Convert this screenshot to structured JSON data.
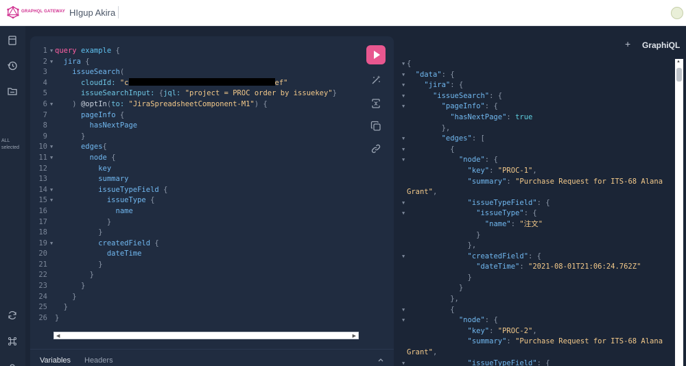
{
  "header": {
    "logo_text": "GRAPHQL GATEWAY",
    "site_name": "HIgup Akira"
  },
  "sidebar": {
    "icons": [
      "docs-icon",
      "history-icon",
      "explorer-icon",
      "refresh-icon",
      "shortcuts-icon"
    ],
    "filter_label_line1": "ALL",
    "filter_label_line2": "selected"
  },
  "editor": {
    "line_numbers": [
      "1",
      "2",
      "3",
      "4",
      "5",
      "6",
      "7",
      "8",
      "9",
      "10",
      "11",
      "12",
      "13",
      "14",
      "15",
      "16",
      "17",
      "18",
      "19",
      "20",
      "21",
      "22",
      "23",
      "24",
      "25",
      "26"
    ],
    "query": {
      "l1_kw": "query",
      "l1_name": "example",
      "l2_field": "jira",
      "l3_field": "issueSearch",
      "l4_arg": "cloudId:",
      "l4_str_start": "\"c",
      "l4_str_end": "ef\"",
      "l5_arg": "issueSearchInput:",
      "l5_inner_arg": "jql:",
      "l5_str": "\"project = PROC order by issuekey\"",
      "l6_directive": "@optIn",
      "l6_arg": "to:",
      "l6_str": "\"JiraSpreadsheetComponent-M1\"",
      "l7_field": "pageInfo",
      "l8_field": "hasNextPage",
      "l10_field": "edges",
      "l11_field": "node",
      "l12_field": "key",
      "l13_field": "summary",
      "l14_field": "issueTypeField",
      "l15_field": "issueType",
      "l16_field": "name",
      "l19_field": "createdField",
      "l20_field": "dateTime"
    },
    "tabs": {
      "variables": "Variables",
      "headers": "Headers"
    },
    "toolbar_icons": [
      "run-icon",
      "prettify-icon",
      "merge-icon",
      "copy-icon",
      "share-link-icon"
    ]
  },
  "result_header": {
    "add_tab": "+",
    "brand": "GraphiQL"
  },
  "result": {
    "k_data": "\"data\"",
    "k_jira": "\"jira\"",
    "k_issueSearch": "\"issueSearch\"",
    "k_pageInfo": "\"pageInfo\"",
    "k_hasNextPage": "\"hasNextPage\"",
    "v_true": "true",
    "k_edges": "\"edges\"",
    "k_node": "\"node\"",
    "k_key": "\"key\"",
    "v_key1": "\"PROC-1\"",
    "k_summary": "\"summary\"",
    "v_summary1_a": "\"Purchase Request for ITS-68 Alana",
    "v_summary1_b": "Grant\"",
    "k_issueTypeField": "\"issueTypeField\"",
    "k_issueType": "\"issueType\"",
    "k_name": "\"name\"",
    "v_name1": "\"注文\"",
    "k_createdField": "\"createdField\"",
    "k_dateTime": "\"dateTime\"",
    "v_dateTime1": "\"2021-08-01T21:06:24.762Z\"",
    "v_key2": "\"PROC-2\"",
    "v_summary2_a": "\"Purchase Request for ITS-68 Alana",
    "v_summary2_b": "Grant\""
  }
}
